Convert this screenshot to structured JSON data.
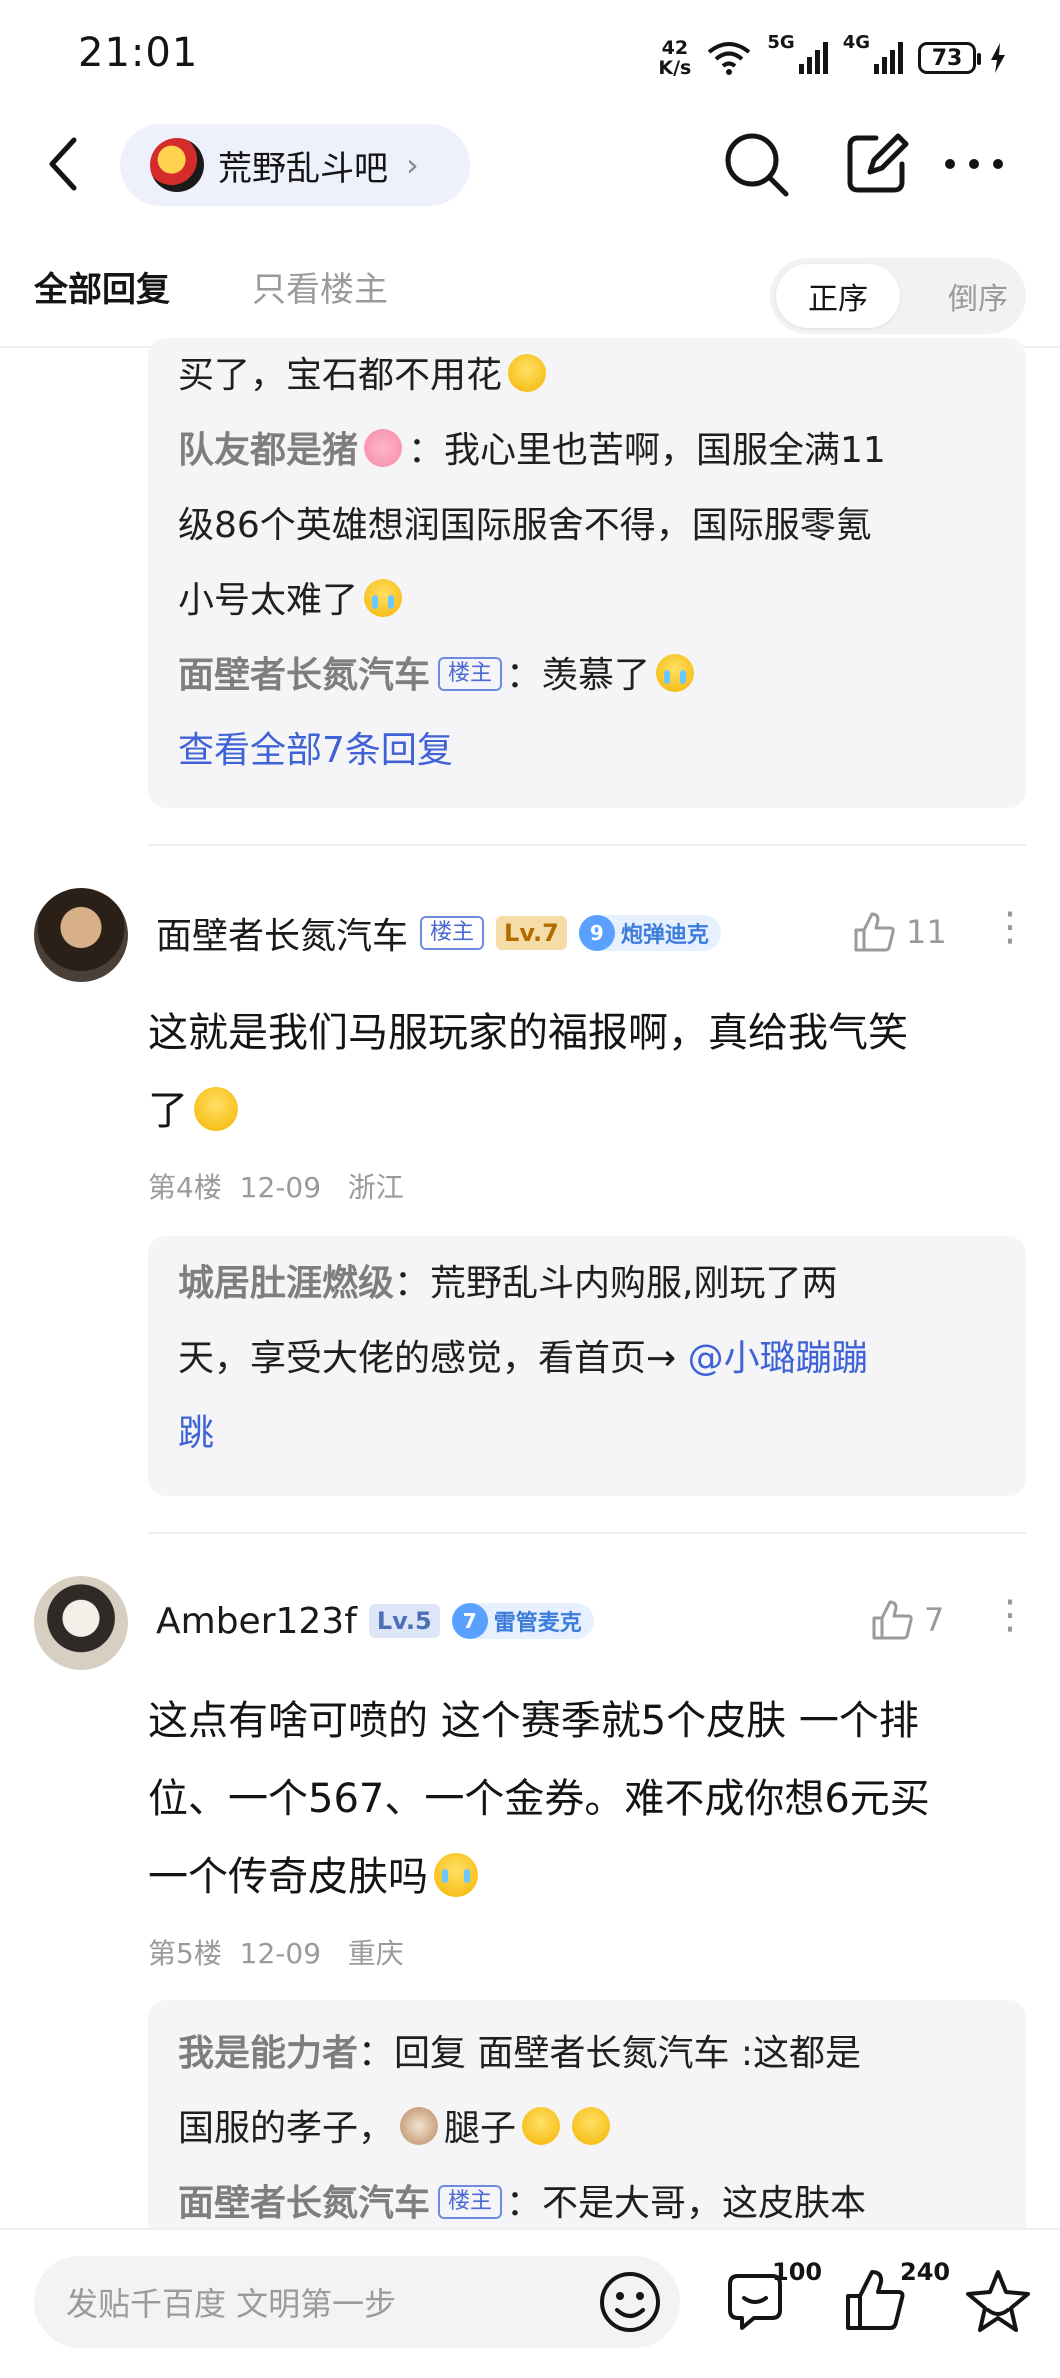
{
  "status_bar": {
    "time": "21:01",
    "net_speed_value": "42",
    "net_speed_unit": "K/s",
    "signal_1": "5G",
    "signal_2": "4G",
    "battery": "73"
  },
  "nav": {
    "forum_name": "荒野乱斗吧"
  },
  "tabs": {
    "all_replies": "全部回复",
    "owner_only": "只看楼主",
    "sort_asc": "正序",
    "sort_desc": "倒序"
  },
  "top_reply_box": {
    "line1": "买了，宝石都不用花",
    "r2_name": "队友都是猪",
    "r2_text_a": "：我心里也苦啊，国服全满11",
    "r2_text_b": "级86个英雄想润国际服舍不得，国际服零氪",
    "r2_text_c": "小号太难了",
    "r3_name": "面壁者长氮汽车",
    "r3_tag": "楼主",
    "r3_text": "：羡慕了",
    "view_all": "查看全部7条回复"
  },
  "posts": [
    {
      "username": "面壁者长氮汽车",
      "owner_tag": "楼主",
      "level": "Lv.7",
      "medal_num": "9",
      "medal_name": "炮弹迪克",
      "likes": "11",
      "text_a": "这就是我们马服玩家的福报啊，真给我气笑",
      "text_b": "了",
      "floor": "第4楼",
      "date": "12-09",
      "location": "浙江",
      "reply": {
        "name": "城居肚涯燃级",
        "text_a": "：荒野乱斗内购服,刚玩了两",
        "text_b": "天，享受大佬的感觉，看首页→ ",
        "mention_a": "@小璐蹦蹦",
        "mention_b": "跳"
      }
    },
    {
      "username": "Amber123f",
      "level": "Lv.5",
      "medal_num": "7",
      "medal_name": "雷管麦克",
      "likes": "7",
      "text_a": "这点有啥可喷的 这个赛季就5个皮肤 一个排",
      "text_b": "位、一个567、一个金券。难不成你想6元买",
      "text_c": "一个传奇皮肤吗",
      "floor": "第5楼",
      "date": "12-09",
      "location": "重庆",
      "reply": {
        "r1_name": "我是能力者",
        "r1_text_a": "：回复 面壁者长氮汽车 :这都是",
        "r1_text_b": "国服的孝子，",
        "r1_text_c": "腿子",
        "r2_name": "面壁者长氮汽车",
        "r2_tag": "楼主",
        "r2_text": "：不是大哥，这皮肤本"
      }
    }
  ],
  "bottom_bar": {
    "input_placeholder": "发贴千百度 文明第一步",
    "comments_count": "100",
    "likes_count": "240"
  }
}
